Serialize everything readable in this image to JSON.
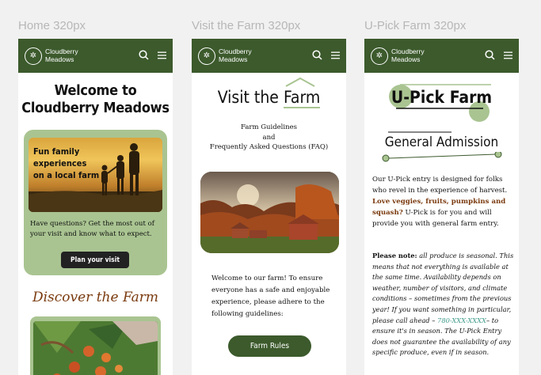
{
  "frames": [
    {
      "label": "Home 320px"
    },
    {
      "label": "Visit the Farm 320px"
    },
    {
      "label": "U-Pick Farm 320px"
    }
  ],
  "header": {
    "brand_line1": "Cloudberry",
    "brand_line2": "Meadows"
  },
  "home": {
    "title_line1": "Welcome to",
    "title_line2": "Cloudberry Meadows",
    "hero_text_line1": "Fun family",
    "hero_text_line2": "experiences",
    "hero_text_line3": "on a local farm",
    "card_body": "Have questions? Get the most out of your visit and know what to expect.",
    "plan_button": "Plan your visit",
    "discover_heading": "Discover the Farm"
  },
  "visit": {
    "title_part1": "Visit the ",
    "title_part2": "Farm",
    "subtitle_line1": "Farm Guidelines",
    "subtitle_line2": "and",
    "subtitle_line3": "Frequently Asked Questions (FAQ)",
    "body": "Welcome to our farm! To ensure everyone has a safe and enjoyable experience, please adhere to the following guidelines:",
    "rules_button": "Farm Rules"
  },
  "upick": {
    "title": "U-Pick Farm",
    "general_heading": "General Admission",
    "p1_start": "Our U-Pick entry is designed for folks who revel in the experience of harvest. ",
    "p1_highlight": "Love veggies, fruits, pumpkins and squash?",
    "p1_end": " U-Pick is for you and will provide you with general farm entry.",
    "note_label": "Please note:",
    "note_text": " all produce is seasonal. This means that not everything is available at the same time. Availability depends on weather, number of visitors, and climate conditions – sometimes from the previous year! If you want something in particular, please call ahead – ",
    "phone": "780-XXX-XXXX",
    "note_end": "– to ensure it's in season. The U-Pick Entry does not guarantee the availability of any specific produce, even if in season."
  },
  "colors": {
    "header_green": "#3c5a2c",
    "card_green": "#a9c491",
    "accent_brown": "#7a3a0e"
  }
}
